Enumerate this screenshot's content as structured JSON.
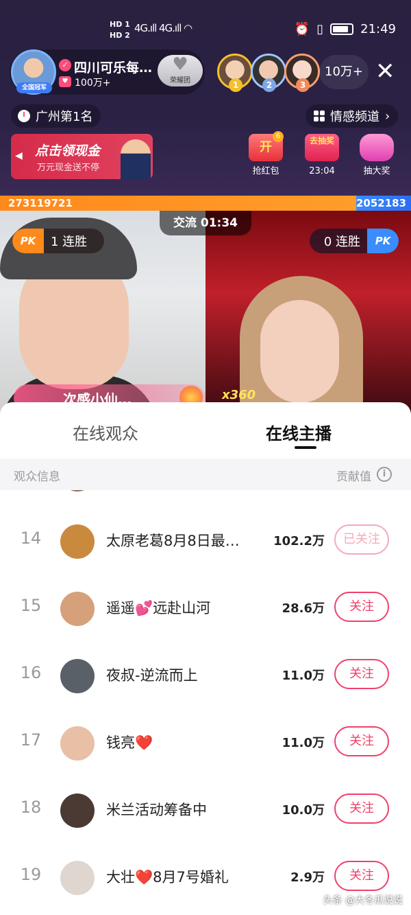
{
  "status_bar": {
    "hd1": "HD 1",
    "hd2": "HD 2",
    "sig1": "4G.ıll",
    "sig2": "4G.ıll",
    "time": "21:49"
  },
  "host": {
    "name": "四川可乐每…",
    "fans": "100万+",
    "badge": "全国冠军",
    "glory_label": "荣耀团"
  },
  "top_viewers": {
    "ranks": [
      "1",
      "2",
      "3"
    ],
    "colors": [
      "#f5c02a",
      "#9fc6ff",
      "#f7a071"
    ],
    "count": "10万+"
  },
  "city_rank": "广州第1名",
  "channel": "情感频道",
  "promo": {
    "title": "点击领现金",
    "subtitle": "万元现金送不停"
  },
  "activities": [
    {
      "label": "抢红包",
      "icon_text": "开",
      "badge": "6"
    },
    {
      "label": "23:04",
      "icon_text": "去抽奖"
    },
    {
      "label": "抽大奖"
    }
  ],
  "pk": {
    "left_score": "273119721",
    "right_score": "2052183",
    "timer": "交流 01:34",
    "left_streak": "1  连胜",
    "right_streak": "0  连胜",
    "pk_tag": "PK"
  },
  "gift": {
    "name": "次感小仙…",
    "count": "x360"
  },
  "sheet": {
    "tab_viewers": "在线观众",
    "tab_anchors": "在线主播",
    "header_info": "观众信息",
    "header_value": "贡献值"
  },
  "rows": [
    {
      "rank": "14",
      "name": "太原老葛8月8日最…",
      "value": "102.2万",
      "button": "已关注",
      "avatar": "#c98a3e"
    },
    {
      "rank": "15",
      "name": "遥遥💕远赴山河",
      "value": "28.6万",
      "button": "关注",
      "avatar": "#d6a07a"
    },
    {
      "rank": "16",
      "name": "夜叔-逆流而上",
      "value": "11.0万",
      "button": "关注",
      "avatar": "#5a6068"
    },
    {
      "rank": "17",
      "name": "钱亮❤️",
      "value": "11.0万",
      "button": "关注",
      "avatar": "#e8c0a6"
    },
    {
      "rank": "18",
      "name": "米兰活动筹备中",
      "value": "10.0万",
      "button": "关注",
      "avatar": "#4b3a34"
    },
    {
      "rank": "19",
      "name": "大壮❤️8月7号婚礼",
      "value": "2.9万",
      "button": "关注",
      "avatar": "#e0d6d0"
    }
  ],
  "watermark": "头条 @大冬瓜说说"
}
